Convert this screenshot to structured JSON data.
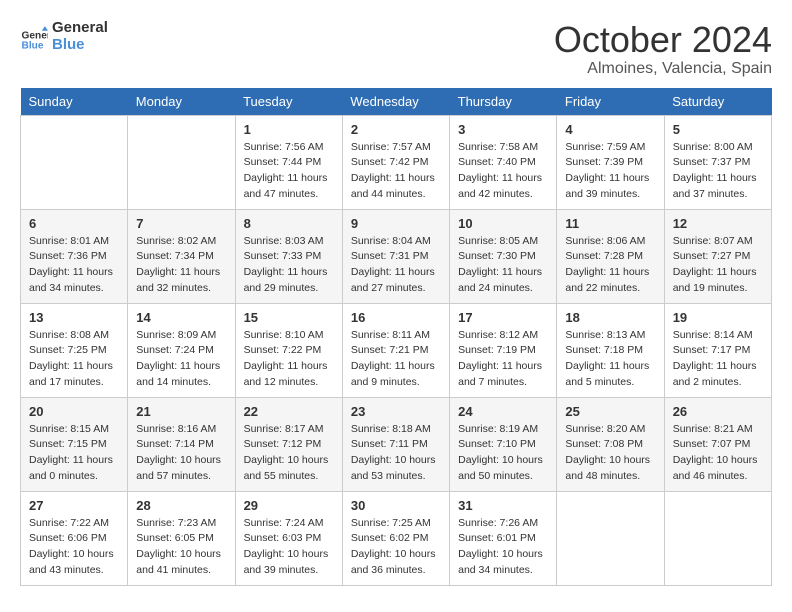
{
  "logo": {
    "line1": "General",
    "line2": "Blue"
  },
  "title": "October 2024",
  "location": "Almoines, Valencia, Spain",
  "weekdays": [
    "Sunday",
    "Monday",
    "Tuesday",
    "Wednesday",
    "Thursday",
    "Friday",
    "Saturday"
  ],
  "weeks": [
    [
      null,
      null,
      {
        "day": "1",
        "sunrise": "Sunrise: 7:56 AM",
        "sunset": "Sunset: 7:44 PM",
        "daylight": "Daylight: 11 hours and 47 minutes."
      },
      {
        "day": "2",
        "sunrise": "Sunrise: 7:57 AM",
        "sunset": "Sunset: 7:42 PM",
        "daylight": "Daylight: 11 hours and 44 minutes."
      },
      {
        "day": "3",
        "sunrise": "Sunrise: 7:58 AM",
        "sunset": "Sunset: 7:40 PM",
        "daylight": "Daylight: 11 hours and 42 minutes."
      },
      {
        "day": "4",
        "sunrise": "Sunrise: 7:59 AM",
        "sunset": "Sunset: 7:39 PM",
        "daylight": "Daylight: 11 hours and 39 minutes."
      },
      {
        "day": "5",
        "sunrise": "Sunrise: 8:00 AM",
        "sunset": "Sunset: 7:37 PM",
        "daylight": "Daylight: 11 hours and 37 minutes."
      }
    ],
    [
      {
        "day": "6",
        "sunrise": "Sunrise: 8:01 AM",
        "sunset": "Sunset: 7:36 PM",
        "daylight": "Daylight: 11 hours and 34 minutes."
      },
      {
        "day": "7",
        "sunrise": "Sunrise: 8:02 AM",
        "sunset": "Sunset: 7:34 PM",
        "daylight": "Daylight: 11 hours and 32 minutes."
      },
      {
        "day": "8",
        "sunrise": "Sunrise: 8:03 AM",
        "sunset": "Sunset: 7:33 PM",
        "daylight": "Daylight: 11 hours and 29 minutes."
      },
      {
        "day": "9",
        "sunrise": "Sunrise: 8:04 AM",
        "sunset": "Sunset: 7:31 PM",
        "daylight": "Daylight: 11 hours and 27 minutes."
      },
      {
        "day": "10",
        "sunrise": "Sunrise: 8:05 AM",
        "sunset": "Sunset: 7:30 PM",
        "daylight": "Daylight: 11 hours and 24 minutes."
      },
      {
        "day": "11",
        "sunrise": "Sunrise: 8:06 AM",
        "sunset": "Sunset: 7:28 PM",
        "daylight": "Daylight: 11 hours and 22 minutes."
      },
      {
        "day": "12",
        "sunrise": "Sunrise: 8:07 AM",
        "sunset": "Sunset: 7:27 PM",
        "daylight": "Daylight: 11 hours and 19 minutes."
      }
    ],
    [
      {
        "day": "13",
        "sunrise": "Sunrise: 8:08 AM",
        "sunset": "Sunset: 7:25 PM",
        "daylight": "Daylight: 11 hours and 17 minutes."
      },
      {
        "day": "14",
        "sunrise": "Sunrise: 8:09 AM",
        "sunset": "Sunset: 7:24 PM",
        "daylight": "Daylight: 11 hours and 14 minutes."
      },
      {
        "day": "15",
        "sunrise": "Sunrise: 8:10 AM",
        "sunset": "Sunset: 7:22 PM",
        "daylight": "Daylight: 11 hours and 12 minutes."
      },
      {
        "day": "16",
        "sunrise": "Sunrise: 8:11 AM",
        "sunset": "Sunset: 7:21 PM",
        "daylight": "Daylight: 11 hours and 9 minutes."
      },
      {
        "day": "17",
        "sunrise": "Sunrise: 8:12 AM",
        "sunset": "Sunset: 7:19 PM",
        "daylight": "Daylight: 11 hours and 7 minutes."
      },
      {
        "day": "18",
        "sunrise": "Sunrise: 8:13 AM",
        "sunset": "Sunset: 7:18 PM",
        "daylight": "Daylight: 11 hours and 5 minutes."
      },
      {
        "day": "19",
        "sunrise": "Sunrise: 8:14 AM",
        "sunset": "Sunset: 7:17 PM",
        "daylight": "Daylight: 11 hours and 2 minutes."
      }
    ],
    [
      {
        "day": "20",
        "sunrise": "Sunrise: 8:15 AM",
        "sunset": "Sunset: 7:15 PM",
        "daylight": "Daylight: 11 hours and 0 minutes."
      },
      {
        "day": "21",
        "sunrise": "Sunrise: 8:16 AM",
        "sunset": "Sunset: 7:14 PM",
        "daylight": "Daylight: 10 hours and 57 minutes."
      },
      {
        "day": "22",
        "sunrise": "Sunrise: 8:17 AM",
        "sunset": "Sunset: 7:12 PM",
        "daylight": "Daylight: 10 hours and 55 minutes."
      },
      {
        "day": "23",
        "sunrise": "Sunrise: 8:18 AM",
        "sunset": "Sunset: 7:11 PM",
        "daylight": "Daylight: 10 hours and 53 minutes."
      },
      {
        "day": "24",
        "sunrise": "Sunrise: 8:19 AM",
        "sunset": "Sunset: 7:10 PM",
        "daylight": "Daylight: 10 hours and 50 minutes."
      },
      {
        "day": "25",
        "sunrise": "Sunrise: 8:20 AM",
        "sunset": "Sunset: 7:08 PM",
        "daylight": "Daylight: 10 hours and 48 minutes."
      },
      {
        "day": "26",
        "sunrise": "Sunrise: 8:21 AM",
        "sunset": "Sunset: 7:07 PM",
        "daylight": "Daylight: 10 hours and 46 minutes."
      }
    ],
    [
      {
        "day": "27",
        "sunrise": "Sunrise: 7:22 AM",
        "sunset": "Sunset: 6:06 PM",
        "daylight": "Daylight: 10 hours and 43 minutes."
      },
      {
        "day": "28",
        "sunrise": "Sunrise: 7:23 AM",
        "sunset": "Sunset: 6:05 PM",
        "daylight": "Daylight: 10 hours and 41 minutes."
      },
      {
        "day": "29",
        "sunrise": "Sunrise: 7:24 AM",
        "sunset": "Sunset: 6:03 PM",
        "daylight": "Daylight: 10 hours and 39 minutes."
      },
      {
        "day": "30",
        "sunrise": "Sunrise: 7:25 AM",
        "sunset": "Sunset: 6:02 PM",
        "daylight": "Daylight: 10 hours and 36 minutes."
      },
      {
        "day": "31",
        "sunrise": "Sunrise: 7:26 AM",
        "sunset": "Sunset: 6:01 PM",
        "daylight": "Daylight: 10 hours and 34 minutes."
      },
      null,
      null
    ]
  ]
}
